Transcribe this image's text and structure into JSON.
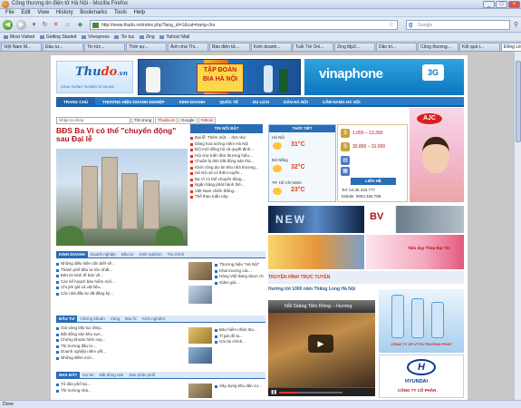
{
  "window": {
    "title": "Công thương tin điện tử Hà Nội - Mozilla Firefox"
  },
  "menu": [
    "File",
    "Edit",
    "View",
    "History",
    "Bookmarks",
    "Tools",
    "Help"
  ],
  "nav": {
    "url": "http://www.thudo.vn/index.php?lang_id=1&cat=trang-chu",
    "search_placeholder": "Google"
  },
  "bookmarks": [
    "Most Visited",
    "Getting Started",
    "Vnexpress",
    "Tin tuc",
    "Zing",
    "Yahoo! Mail"
  ],
  "tabs": [
    "Việt Nam M...",
    "Đầu tư...",
    "Tin tức...",
    "Thời sự...",
    "Ảnh nhà Thi...",
    "Báo điện tử...",
    "Kinh doanh...",
    "Tuổi Trẻ Onl...",
    "Zing Mp3...",
    "Dân trí...",
    "Công thương...",
    "Kết quả t...",
    "Đống Lé..."
  ],
  "status": "Done",
  "site": {
    "logo_name": "Thu",
    "logo_name_red": "do",
    "logo_tld": ".vn",
    "logo_tag": "CỔNG THÔNG TIN ĐIỆN TỬ HÀ NỘI",
    "banner_beer": "TẬP ĐOÀN BIA HÀ NỘI",
    "banner_vina": "vinaphone",
    "banner_3g": "3G",
    "nav": [
      "TRANG CHỦ",
      "THƯƠNG HIỆU DOANH NGHIỆP",
      "KINH DOANH",
      "QUỐC TẾ",
      "DU LỊCH",
      "DÂN HÀ NỘI",
      "CẨM NANG HÀ NỘI"
    ],
    "search_placeholder": "Nhập từ khóa",
    "search_buttons": [
      "Tìm trong",
      "Thudo.vn",
      "Google",
      "Yahoo!"
    ],
    "headline": "BĐS Ba Vì có thể \"chuyển động\" sau Đại lễ",
    "news_header": "TIN NỔI BẬT",
    "news": [
      "Đại lễ: Thêm một ... đợt nhà",
      "Dâng hoa tưởng niệm Hà Nội",
      "Đổi mới đồng bộ và quyết định...",
      "Hội chợ triển lãm thương hiệu...",
      "Chuẩn bị đón bất động sản thủ...",
      "Khởi công dự án khu nhà thương...",
      "Hà Nội sẽ có thêm tuyến...",
      "Ba Vì có thể chuyển động...",
      "Ngân hàng phát hành thẻ...",
      "Việt Nam chiến thắng...",
      "Thể thao tuần này..."
    ],
    "kinhdoanh": {
      "tabs": [
        "KINH DOANH",
        "Doanh nghiệp",
        "Đầu tư",
        "Kinh nghiệm",
        "Tài chính"
      ],
      "items": [
        "Những điều kiện cần biết về...",
        "Thành phố đầu tư lớn nhất...",
        "Bản tin kinh tế bàn về...",
        "Các kế hoạch bảo hiểm mới...",
        "Chi phí giá cả vật liệu...",
        "Các nhà đầu tư đã đăng ký..."
      ],
      "side": [
        "Thương hiệu \"Hà Nội\"",
        "Khai trương các...",
        "Hàng Việt đang được chọn...",
        "Giảm giá..."
      ]
    },
    "dautu": {
      "tabs": [
        "ĐẦU TƯ",
        "Chứng khoán",
        "Vàng",
        "Địa ốc",
        "Kinh nghiệm"
      ],
      "items": [
        "Giá vàng tiếp tục tăng...",
        "Bất động sản khu vực...",
        "Chứng khoán hôm nay...",
        "Thị trường đầu tư...",
        "Doanh nghiệp niêm yết...",
        "Những điểm mới..."
      ],
      "side": [
        "Bảo hiểm nhân thọ...",
        "Tỉ giá đô la...",
        "Gói tài chính..."
      ]
    },
    "nhadat": {
      "tabs": [
        "NHÀ ĐẤT",
        "Dự án",
        "Bất động sản",
        "Sàn phân phối"
      ],
      "items": [
        "Tổ dân phố tại...",
        "Thị trường nhà..."
      ],
      "side": [
        "Xây dựng khu dân cư..."
      ]
    },
    "weather": {
      "header": "THỜI TIẾT",
      "cities": [
        {
          "name": "Hà Nội",
          "temp": "31°C"
        },
        {
          "name": "Đà Nẵng",
          "temp": "32°C"
        },
        {
          "name": "TP. Hồ Chí Minh",
          "temp": "23°C"
        }
      ]
    },
    "gold": {
      "price1": "1.050 – 13.300",
      "price2": "30.800 – 31.000",
      "contact_header": "LIÊN HỆ",
      "phone": "Tel: 04.35.333.777",
      "mobile": "Mobile: 0903.456.789"
    },
    "ads": {
      "ajc": "AJC",
      "new": "NEW",
      "bv": "BV",
      "hutrich": "Tấm dạy Thép Đạt Tin",
      "hyundai": "HYUNDAI",
      "truongphat": "CÔNG TY CP VTTN TRƯỜNG PHÁT",
      "congty": "CÔNG TY CỔ PHẦN"
    },
    "video": {
      "section": "TRUYỀN HÌNH TRỰC TUYẾN",
      "caption": "Hướng tới 1000 năm Thăng Long Hà Nội",
      "title": "Nỗi Giáng Tiên Rồng – Hương"
    }
  }
}
